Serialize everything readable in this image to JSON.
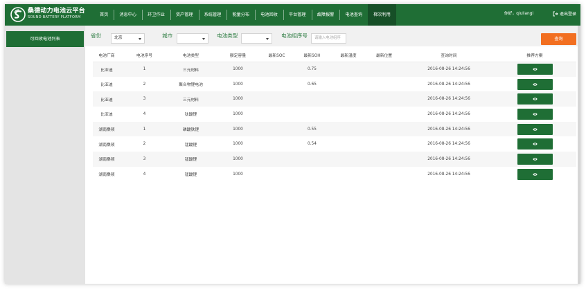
{
  "brand": {
    "title": "桑德动力电池云平台",
    "subtitle": "SOUND BATTERY PLATFORM",
    "color": "#1f6e35"
  },
  "nav": {
    "items": [
      "首页",
      "消息中心",
      "环卫作业",
      "资产管理",
      "系统管理",
      "能量分布",
      "电池回收",
      "平台管理",
      "故障报警",
      "电池查询",
      "梯次利用"
    ],
    "active_index": 10
  },
  "user": {
    "greeting": "你好，qiuliangi",
    "logout_label": "退出登录"
  },
  "sidebar": {
    "items": [
      {
        "label": "可回收电池列表",
        "active": true
      }
    ]
  },
  "filters": {
    "province_label": "省份",
    "province_value": "北京",
    "city_label": "城市",
    "city_value": "",
    "type_label": "电池类型",
    "type_value": "",
    "group_label": "电池组序号",
    "group_placeholder": "请输入电池组序",
    "query_label": "查询",
    "query_color": "#f26f21"
  },
  "table": {
    "headers": [
      "电池厂商",
      "电池序号",
      "电池类型",
      "额定容量",
      "最新SOC",
      "最新SOH",
      "最新温度",
      "最新位置",
      "查询时间",
      "推荐方案"
    ],
    "rows": [
      [
        "比亚迪",
        "1",
        "三元材料",
        "1000",
        "",
        "0.75",
        "",
        "",
        "2016-08-26 14:24:56"
      ],
      [
        "比亚迪",
        "2",
        "聚合物锂电池",
        "1000",
        "",
        "0.65",
        "",
        "",
        "2016-08-26 14:24:56"
      ],
      [
        "比亚迪",
        "3",
        "三元材料",
        "1000",
        "",
        "",
        "",
        "",
        "2016-08-26 14:24:56"
      ],
      [
        "比亚迪",
        "4",
        "钛酸锂",
        "1000",
        "",
        "",
        "",
        "",
        "2016-08-26 14:24:56"
      ],
      [
        "湖南桑顿",
        "1",
        "磷酸铁锂",
        "1000",
        "",
        "0.55",
        "",
        "",
        "2016-08-26 14:24:56"
      ],
      [
        "湖南桑顿",
        "2",
        "锰酸锂",
        "1000",
        "",
        "0.54",
        "",
        "",
        "2016-08-26 14:24:56"
      ],
      [
        "湖南桑顿",
        "3",
        "锰酸锂",
        "1000",
        "",
        "",
        "",
        "",
        "2016-08-26 14:24:56"
      ],
      [
        "湖南桑顿",
        "4",
        "锰酸锂",
        "1000",
        "",
        "",
        "",
        "",
        "2016-08-26 14:24:56"
      ]
    ],
    "action_icon": "eye-icon"
  }
}
